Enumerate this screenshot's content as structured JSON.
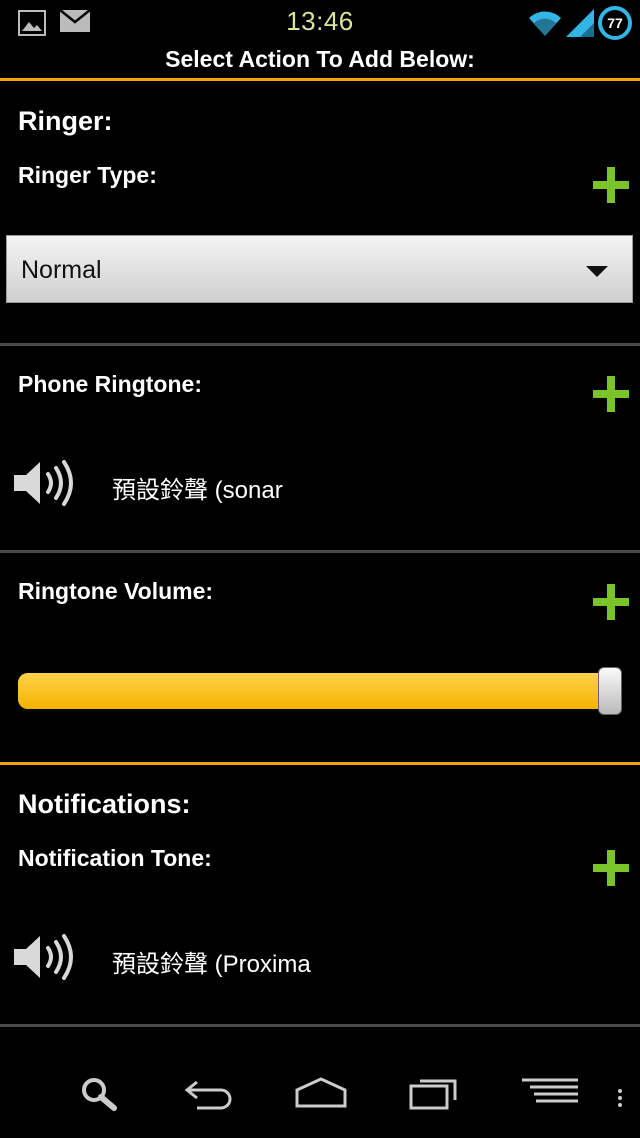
{
  "status_bar": {
    "time": "13:46",
    "battery_level": "77",
    "icons": [
      "image-icon",
      "mail-icon",
      "wifi-icon",
      "signal-icon",
      "battery-icon"
    ]
  },
  "header": {
    "title": "Select Action To Add Below:"
  },
  "ringer": {
    "section_title": "Ringer:",
    "ringer_type": {
      "label": "Ringer Type:",
      "selected": "Normal"
    },
    "phone_ringtone": {
      "label": "Phone Ringtone:",
      "value": "預設鈴聲 (sonar"
    },
    "ringtone_volume": {
      "label": "Ringtone Volume:",
      "level_fraction": 0.98
    }
  },
  "notifications": {
    "section_title": "Notifications:",
    "notification_tone": {
      "label": "Notification Tone:",
      "value": "預設鈴聲 (Proxima"
    }
  },
  "colors": {
    "accent_orange": "#f0a30a",
    "plus_green": "#7ac42a",
    "slider_yellow": "#ffc107",
    "time_color": "#d9e59a"
  },
  "nav_bar": {
    "icons": [
      "search-icon",
      "back-icon",
      "home-icon",
      "recent-apps-icon",
      "menu-icon",
      "overflow-icon"
    ]
  }
}
